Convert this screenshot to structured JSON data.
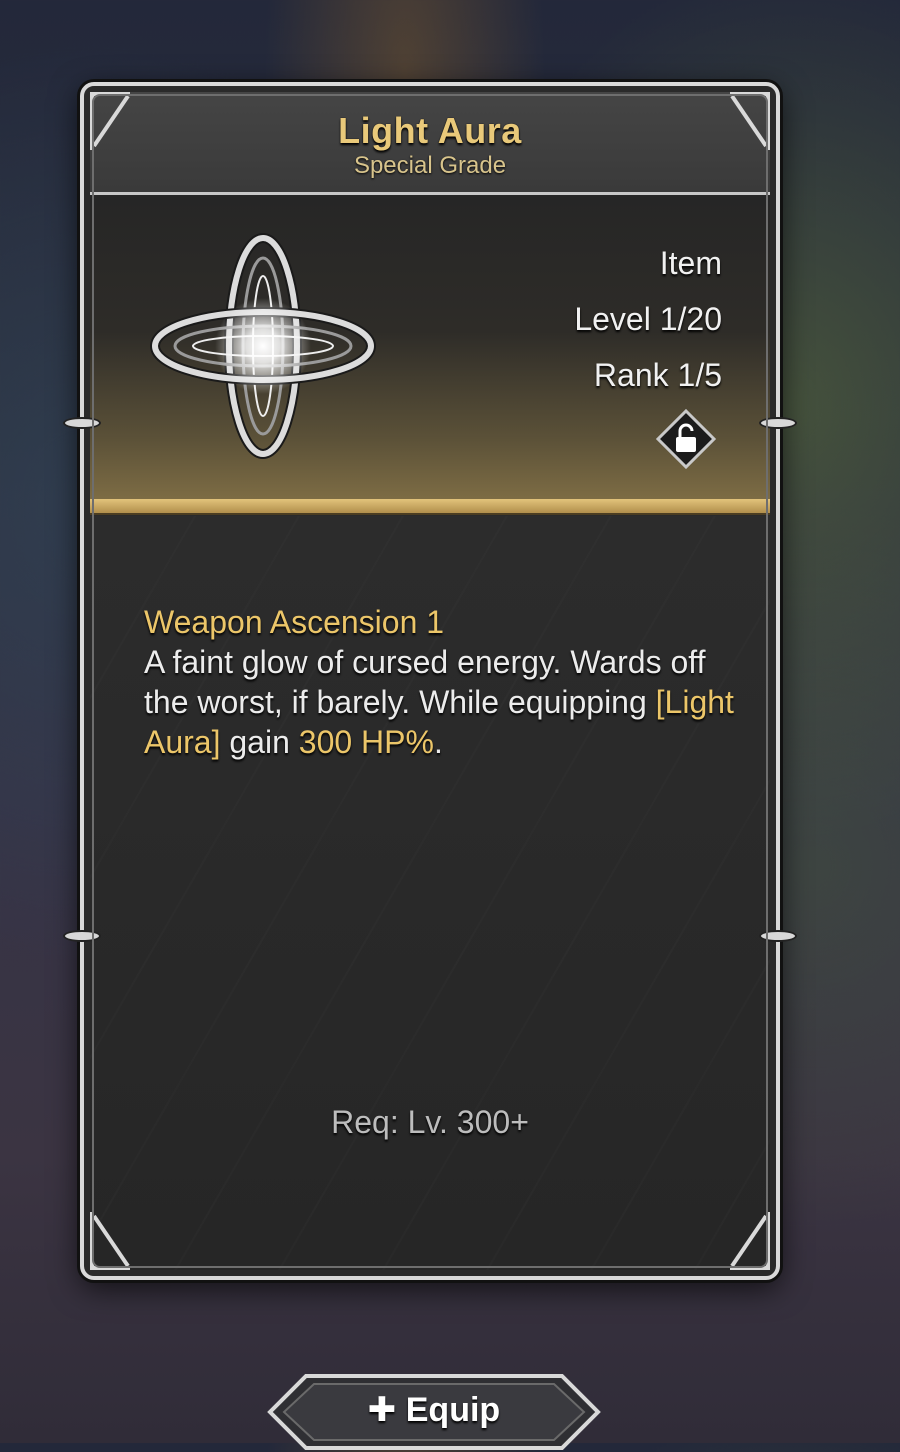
{
  "item": {
    "name": "Light Aura",
    "grade": "Special Grade",
    "type": "Item",
    "level": "Level 1/20",
    "rank": "Rank 1/5",
    "icon": "four-point-star-relic-icon",
    "lock_state_icon": "unlocked-padlock-icon"
  },
  "description": {
    "heading": "Weapon Ascension 1",
    "text_1": "A faint glow of cursed energy. Wards off the worst, if barely. While equipping ",
    "highlight_item": "[Light Aura]",
    "text_2": " gain ",
    "highlight_value": "300 HP%",
    "text_3": "."
  },
  "requirement": "Req: Lv. 300+",
  "actions": {
    "equip_label": "Equip",
    "equip_icon": "plus-icon"
  },
  "colors": {
    "title_gold": "#e9c97a",
    "highlight_gold": "#ecc669",
    "frame_silver": "#d9d9d9",
    "panel_dark": "#2a2a2a"
  }
}
